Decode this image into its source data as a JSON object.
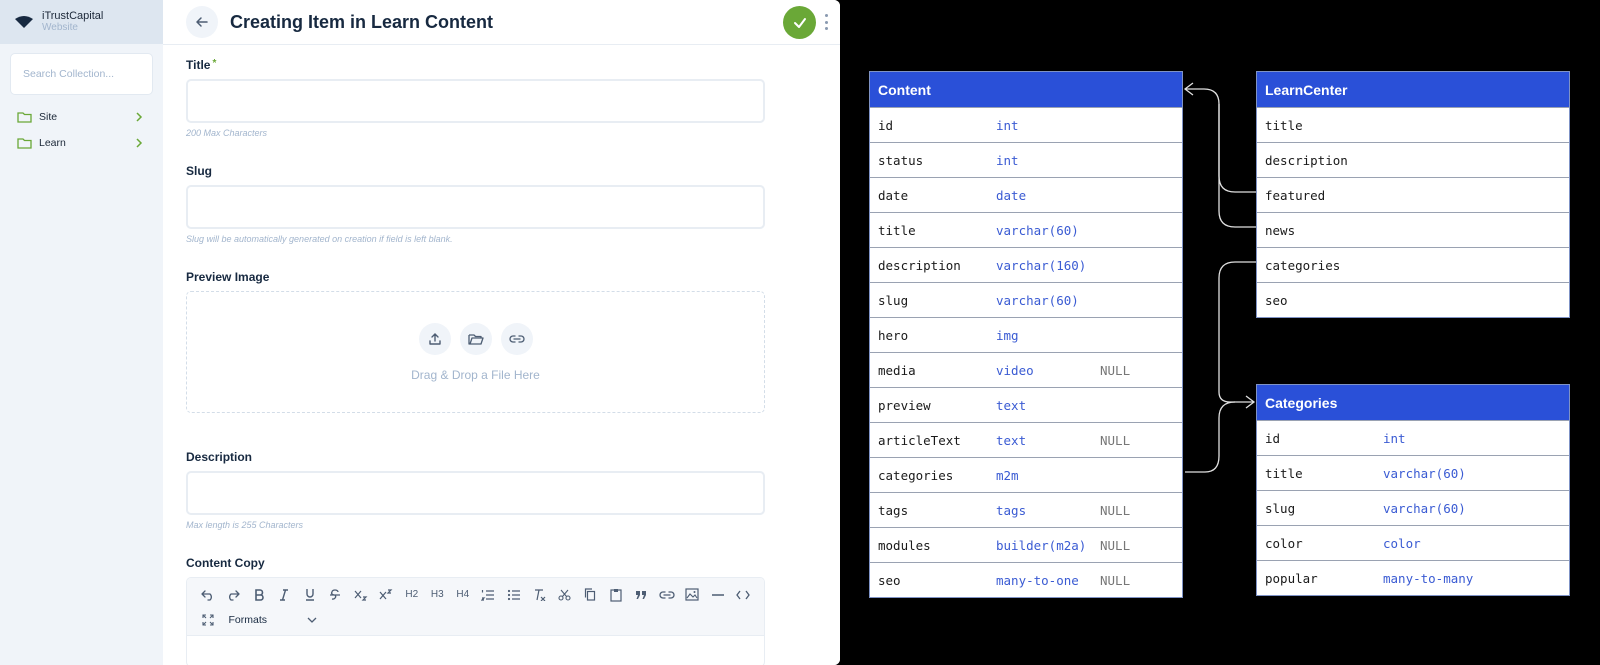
{
  "sidebar": {
    "brand_name": "iTrustCapital",
    "brand_sub": "Website",
    "search_placeholder": "Search Collection...",
    "items": [
      {
        "label": "Site"
      },
      {
        "label": "Learn"
      }
    ]
  },
  "header": {
    "title": "Creating Item in Learn Content"
  },
  "form": {
    "title_label": "Title",
    "title_required": "*",
    "title_hint": "200 Max Characters",
    "slug_label": "Slug",
    "slug_hint": "Slug will be automatically generated on creation if field is left blank.",
    "preview_label": "Preview Image",
    "dropzone_text": "Drag & Drop a File Here",
    "description_label": "Description",
    "description_hint": "Max length is 255 Characters",
    "copy_label": "Content Copy",
    "formats_label": "Formats",
    "toolbar_headings": [
      "H2",
      "H3",
      "H4"
    ]
  },
  "diagram": {
    "content": {
      "name": "Content",
      "rows": [
        {
          "name": "id",
          "type": "int",
          "null": ""
        },
        {
          "name": "status",
          "type": "int",
          "null": ""
        },
        {
          "name": "date",
          "type": "date",
          "null": ""
        },
        {
          "name": "title",
          "type": "varchar(60)",
          "null": ""
        },
        {
          "name": "description",
          "type": "varchar(160)",
          "null": ""
        },
        {
          "name": "slug",
          "type": "varchar(60)",
          "null": ""
        },
        {
          "name": "hero",
          "type": "img",
          "null": ""
        },
        {
          "name": "media",
          "type": "video",
          "null": "NULL"
        },
        {
          "name": "preview",
          "type": "text",
          "null": ""
        },
        {
          "name": "articleText",
          "type": "text",
          "null": "NULL"
        },
        {
          "name": "categories",
          "type": "m2m",
          "null": ""
        },
        {
          "name": "tags",
          "type": "tags",
          "null": "NULL"
        },
        {
          "name": "modules",
          "type": "builder(m2a)",
          "null": "NULL"
        },
        {
          "name": "seo",
          "type": "many-to-one",
          "null": "NULL"
        }
      ]
    },
    "learncenter": {
      "name": "LearnCenter",
      "rows": [
        {
          "name": "title"
        },
        {
          "name": "description"
        },
        {
          "name": "featured"
        },
        {
          "name": "news"
        },
        {
          "name": "categories"
        },
        {
          "name": "seo"
        }
      ]
    },
    "categories": {
      "name": "Categories",
      "rows": [
        {
          "name": "id",
          "type": "int"
        },
        {
          "name": "title",
          "type": "varchar(60)"
        },
        {
          "name": "slug",
          "type": "varchar(60)"
        },
        {
          "name": "color",
          "type": "color"
        },
        {
          "name": "popular",
          "type": "many-to-many"
        }
      ]
    }
  }
}
